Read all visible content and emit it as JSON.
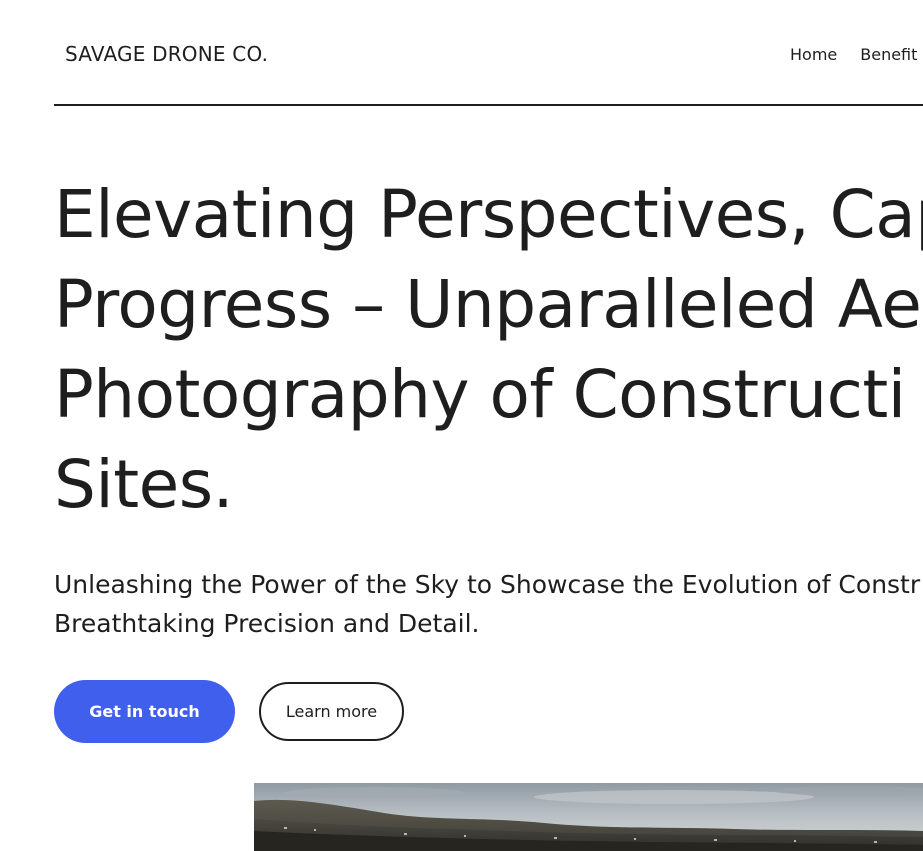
{
  "header": {
    "brand": "SAVAGE DRONE CO.",
    "nav": [
      {
        "label": "Home"
      },
      {
        "label": "Benefit"
      }
    ]
  },
  "hero": {
    "title_lines": [
      "Elevating Perspectives, Cap",
      "Progress – Unparalleled Ae",
      "Photography of Constructi",
      "Sites."
    ],
    "subtitle_lines": [
      "Unleashing the Power of the Sky to Showcase the Evolution of Constr",
      "Breathtaking Precision and Detail."
    ],
    "primary_button": "Get in touch",
    "secondary_button": "Learn more"
  },
  "colors": {
    "accent": "#3f5fec",
    "text": "#1e1e1e",
    "background": "#ffffff"
  }
}
